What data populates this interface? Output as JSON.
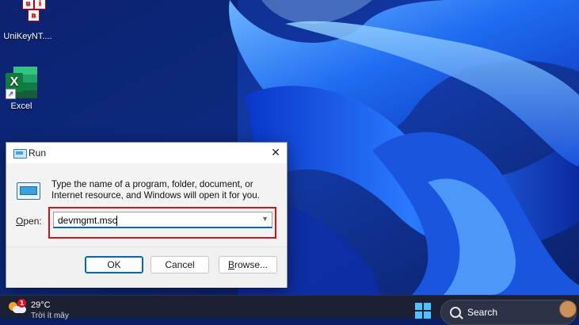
{
  "desktop": {
    "icons": [
      {
        "label": "UniKeyNT....",
        "icon": "unikey-icon",
        "letters": [
          "u",
          "i",
          "n"
        ]
      },
      {
        "label": "Excel",
        "icon": "excel-icon",
        "letter": "X"
      }
    ]
  },
  "run_dialog": {
    "title": "Run",
    "description": "Type the name of a program, folder, document, or Internet resource, and Windows will open it for you.",
    "open_label": "Open:",
    "open_accel": "O",
    "open_rest": "pen:",
    "input_value": "devmgmt.msc",
    "close_glyph": "✕",
    "buttons": {
      "ok": "OK",
      "cancel": "Cancel",
      "browse_accel": "B",
      "browse_rest": "rowse..."
    },
    "highlight_color": "#d1141b"
  },
  "taskbar": {
    "weather": {
      "temp": "29°C",
      "condition": "Trời ít mây",
      "badge": "1"
    },
    "search_label": "Search",
    "accent": "#4cc2ff"
  }
}
